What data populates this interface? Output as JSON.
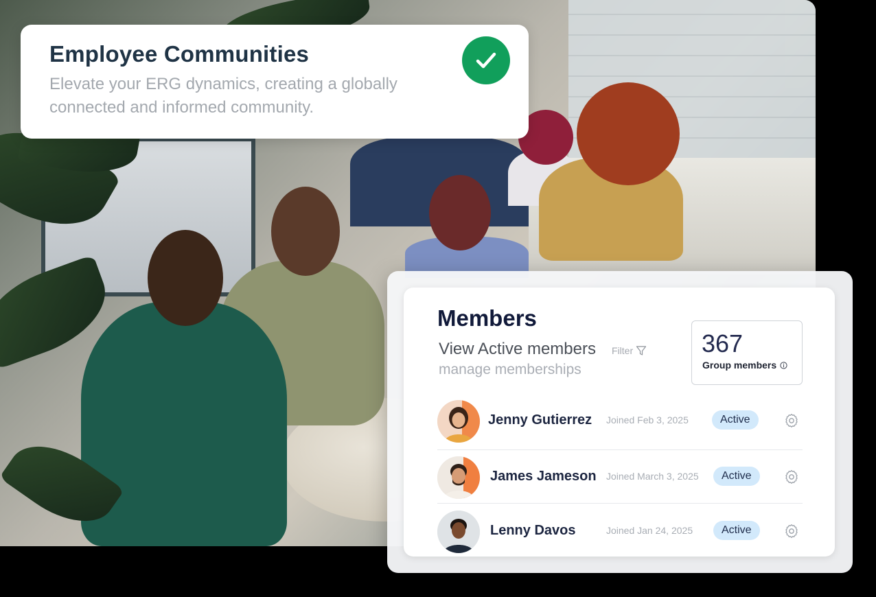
{
  "hero_card": {
    "title": "Employee Communities",
    "subtitle": "Elevate your ERG dynamics, creating a globally connected and informed community.",
    "badge_icon": "check-icon",
    "badge_color": "#119f5b"
  },
  "members_panel": {
    "title": "Members",
    "view_label": "View Active members",
    "filter_label": "Filter",
    "manage_label": "manage memberships",
    "count_value": "367",
    "count_label": "Group members",
    "members": [
      {
        "name": "Jenny Gutierrez",
        "joined": "Joined Feb 3, 2025",
        "status": "Active"
      },
      {
        "name": "James Jameson",
        "joined": "Joined March 3, 2025",
        "status": "Active"
      },
      {
        "name": "Lenny Davos",
        "joined": "Joined Jan 24, 2025",
        "status": "Active"
      }
    ],
    "status_color": "#d2e9fb"
  }
}
